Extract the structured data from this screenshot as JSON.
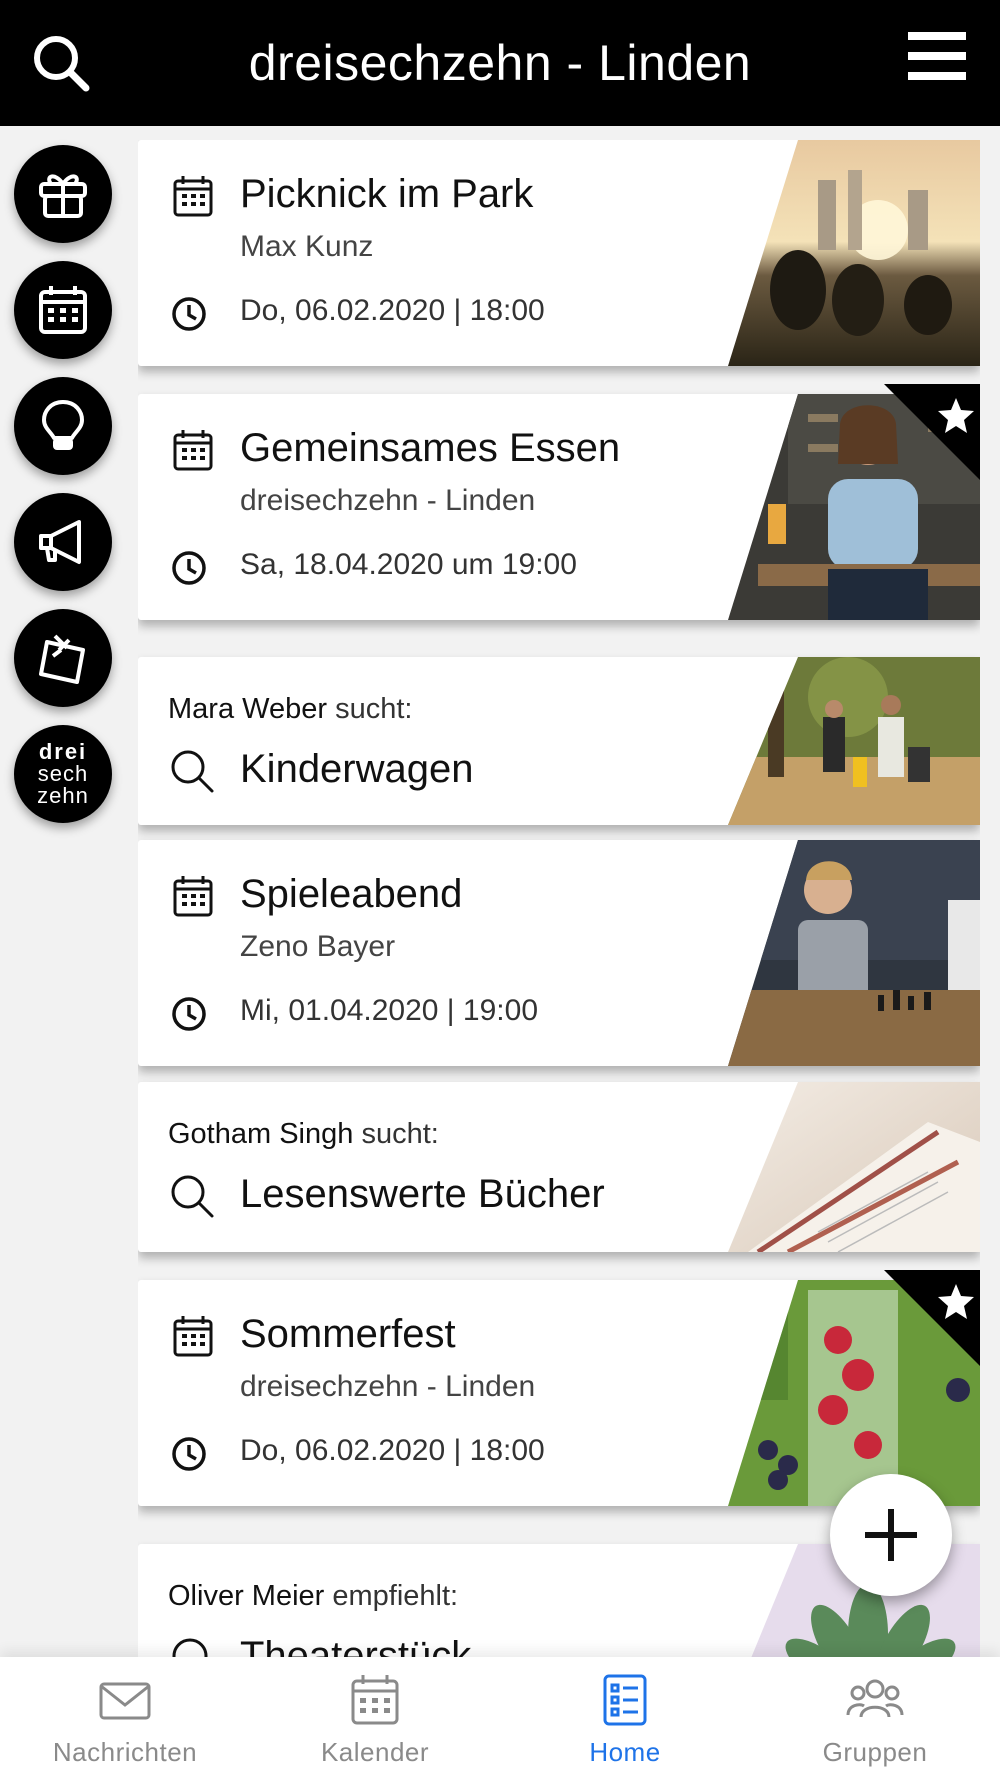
{
  "header": {
    "title": "dreisechzehn - Linden",
    "search_icon": "search-icon",
    "menu_icon": "hamburger-menu-icon"
  },
  "rail": {
    "items": [
      {
        "name": "gift",
        "icon": "gift-icon"
      },
      {
        "name": "calendar",
        "icon": "calendar-icon"
      },
      {
        "name": "ideas",
        "icon": "lightbulb-icon"
      },
      {
        "name": "announcements",
        "icon": "megaphone-icon"
      },
      {
        "name": "pinboard",
        "icon": "pin-note-icon"
      }
    ],
    "logo": {
      "line1": "drei",
      "line2": "sech",
      "line3": "zehn"
    }
  },
  "feed": {
    "cards": [
      {
        "type": "event",
        "title": "Picknick im Park",
        "subtitle": "Max Kunz",
        "time": "Do, 06.02.2020 | 18:00",
        "favorite": false,
        "image": "picnic-park-sunset"
      },
      {
        "type": "event",
        "title": "Gemeinsames Essen",
        "subtitle": "dreisechzehn - Linden",
        "time": "Sa, 18.04.2020 um 19:00",
        "favorite": true,
        "image": "woman-laughing-bar"
      },
      {
        "type": "request",
        "person": "Mara Weber",
        "verb": "sucht:",
        "title": "Kinderwagen",
        "image": "family-walk-autumn"
      },
      {
        "type": "event",
        "title": "Spieleabend",
        "subtitle": "Zeno Bayer",
        "time": "Mi, 01.04.2020 | 19:00",
        "favorite": false,
        "image": "chess-game"
      },
      {
        "type": "request",
        "person": "Gotham Singh",
        "verb": "sucht:",
        "title": "Lesenswerte Bücher",
        "image": "open-book-pages"
      },
      {
        "type": "event",
        "title": "Sommerfest",
        "subtitle": "dreisechzehn - Linden",
        "time": "Do, 06.02.2020 | 18:00",
        "favorite": true,
        "image": "berries-drink"
      },
      {
        "type": "recommendation",
        "person": "Oliver Meier",
        "verb": "empfiehlt:",
        "title": "Theaterstück",
        "image": "succulent-plant"
      }
    ]
  },
  "fab": {
    "icon": "plus-icon"
  },
  "bottom_nav": {
    "items": [
      {
        "label": "Nachrichten",
        "icon": "mail-icon",
        "active": false
      },
      {
        "label": "Kalender",
        "icon": "calendar-icon",
        "active": false
      },
      {
        "label": "Home",
        "icon": "home-list-icon",
        "active": true
      },
      {
        "label": "Gruppen",
        "icon": "groups-icon",
        "active": false
      }
    ]
  },
  "colors": {
    "header_bg": "#000000",
    "accent_active": "#1e73e8",
    "inactive": "#8a8a8a",
    "page_bg": "#f2f2f2"
  }
}
